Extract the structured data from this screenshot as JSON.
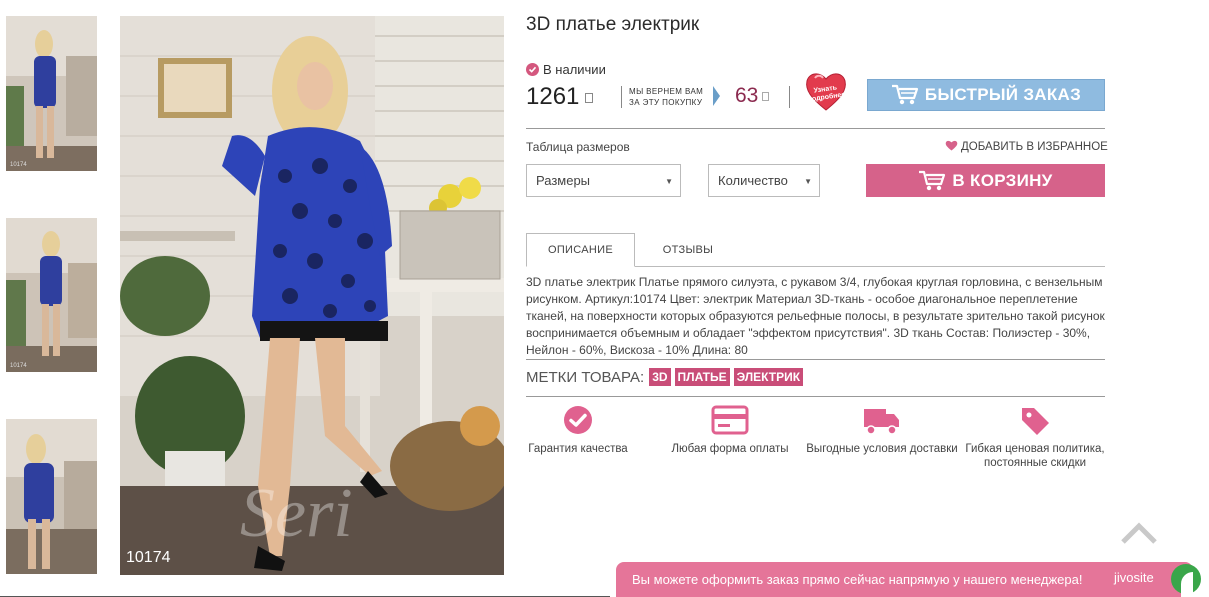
{
  "product": {
    "title": "3D платье электрик",
    "stock_status": "В наличии",
    "price": "1261",
    "refund_text_line1": "МЫ ВЕРНЕМ ВАМ",
    "refund_text_line2": "ЗА ЭТУ ПОКУПКУ",
    "bonus": "63",
    "sku_overlay": "10174"
  },
  "promo": {
    "heart_text": "Узнать подробнее"
  },
  "buttons": {
    "quick_order": "БЫСТРЫЙ ЗАКАЗ",
    "add_to_cart": "В КОРЗИНУ"
  },
  "options": {
    "size_table_link": "Таблица размеров",
    "favorite_link": "ДОБАВИТЬ В ИЗБРАННОЕ",
    "size_select": "Размеры",
    "qty_select": "Количество"
  },
  "tabs": [
    {
      "label": "ОПИСАНИЕ",
      "active": true
    },
    {
      "label": "ОТЗЫВЫ",
      "active": false
    }
  ],
  "description": "3D платье электрик Платье прямого силуэта, с рукавом 3/4, глубокая круглая горловина, с вензельным рисунком. Артикул:10174 Цвет: электрик Материал 3D-ткань - особое диагональное переплетение тканей, на поверхности которых образуются рельефные полосы, в результате зрительно такой рисунок воспринимается объемным и обладает \"эффектом присутствия\". 3D ткань Состав: Полиэстер - 30%, Нейлон - 60%, Вискоза - 10% Длина: 80",
  "tags": {
    "label": "МЕТКИ ТОВАРА:",
    "items": [
      "3D",
      "ПЛАТЬЕ",
      "ЭЛЕКТРИК"
    ]
  },
  "features": [
    {
      "icon": "check-circle-icon",
      "text": "Гарантия качества"
    },
    {
      "icon": "credit-card-icon",
      "text": "Любая форма оплаты"
    },
    {
      "icon": "truck-icon",
      "text": "Выгодные условия доставки"
    },
    {
      "icon": "price-tag-icon",
      "text": "Гибкая ценовая политика, постоянные скидки"
    }
  ],
  "chat": {
    "message": "Вы можете оформить заказ прямо сейчас напрямую у нашего менеджера!",
    "logo": "jivosite"
  },
  "colors": {
    "accent_pink": "#d6628a",
    "quick_order_blue": "#8fbbe0",
    "tag_pink": "#c94d78",
    "chat_pink": "#e57599"
  }
}
